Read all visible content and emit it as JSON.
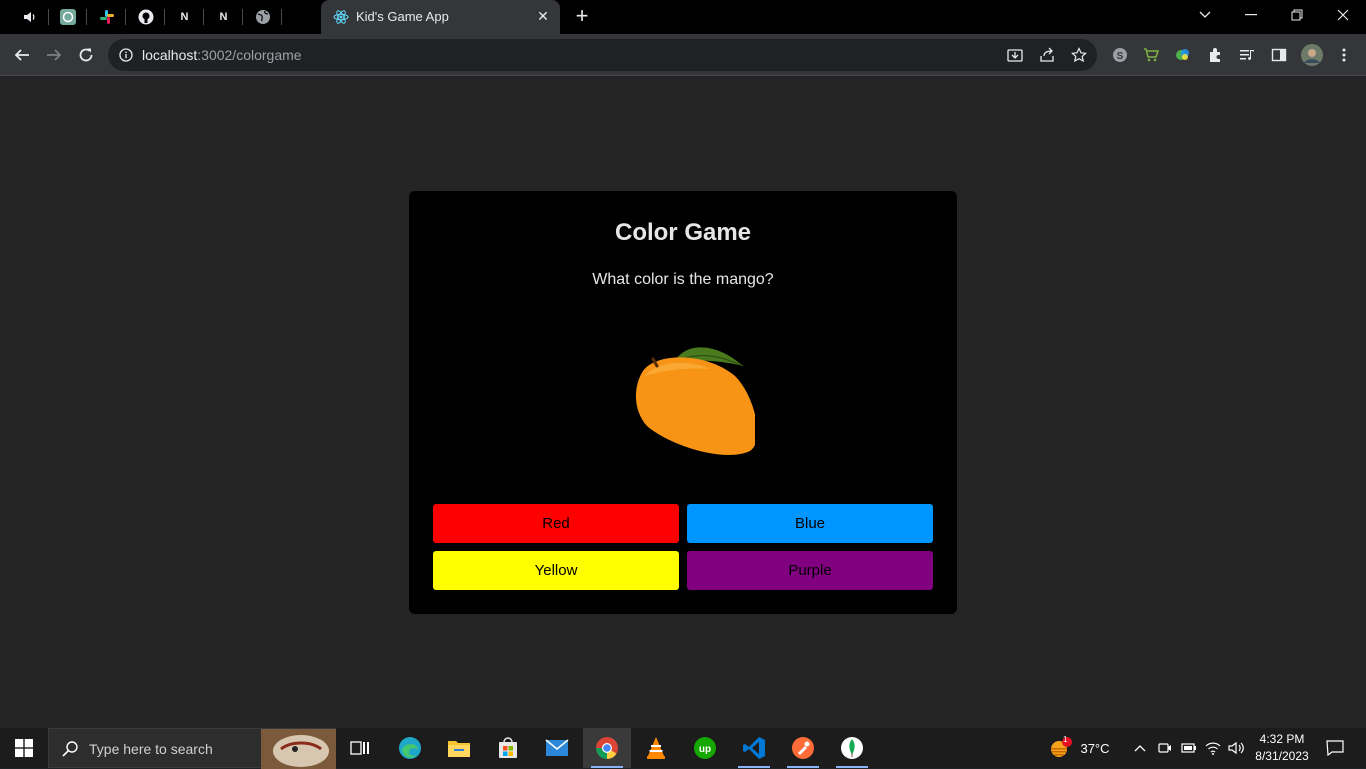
{
  "browser": {
    "active_tab_title": "Kid's Game App",
    "address": {
      "host": "localhost",
      "path": ":3002/colorgame"
    }
  },
  "game": {
    "title": "Color Game",
    "question": "What color is the mango?",
    "image_alt": "mango",
    "options": [
      {
        "label": "Red",
        "color": "#ff0000"
      },
      {
        "label": "Blue",
        "color": "#0096ff"
      },
      {
        "label": "Yellow",
        "color": "#ffff00"
      },
      {
        "label": "Purple",
        "color": "#800080"
      }
    ]
  },
  "taskbar": {
    "search_placeholder": "Type here to search",
    "weather": "37°C",
    "weather_badge": "1",
    "time": "4:32 PM",
    "date": "8/31/2023"
  },
  "colors": {
    "page_bg": "#242424",
    "card_bg": "#000000",
    "chrome_bg": "#35363a"
  }
}
